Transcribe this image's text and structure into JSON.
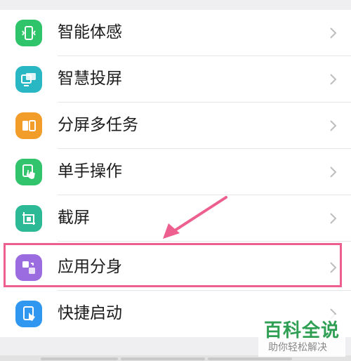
{
  "settings": {
    "items": [
      {
        "label": "智能体感",
        "icon": "motion-sense-icon",
        "color": "#2fc46a"
      },
      {
        "label": "智慧投屏",
        "icon": "screen-cast-icon",
        "color": "#2ab7c4"
      },
      {
        "label": "分屏多任务",
        "icon": "split-screen-icon",
        "color": "#f29d2a"
      },
      {
        "label": "单手操作",
        "icon": "one-hand-icon",
        "color": "#31c46c"
      },
      {
        "label": "截屏",
        "icon": "screenshot-icon",
        "color": "#2bb996"
      },
      {
        "label": "应用分身",
        "icon": "app-clone-icon",
        "color": "#9b6be0"
      },
      {
        "label": "快捷启动",
        "icon": "quick-launch-icon",
        "color": "#2f97f0"
      }
    ],
    "highlighted_index": 5
  },
  "annotation": {
    "highlight_color": "#ec5f8e",
    "arrow_color": "#ec5f8e"
  },
  "watermark": {
    "title": "百科全说",
    "subtitle": "助你轻松解决",
    "color": "#2e9f53"
  }
}
